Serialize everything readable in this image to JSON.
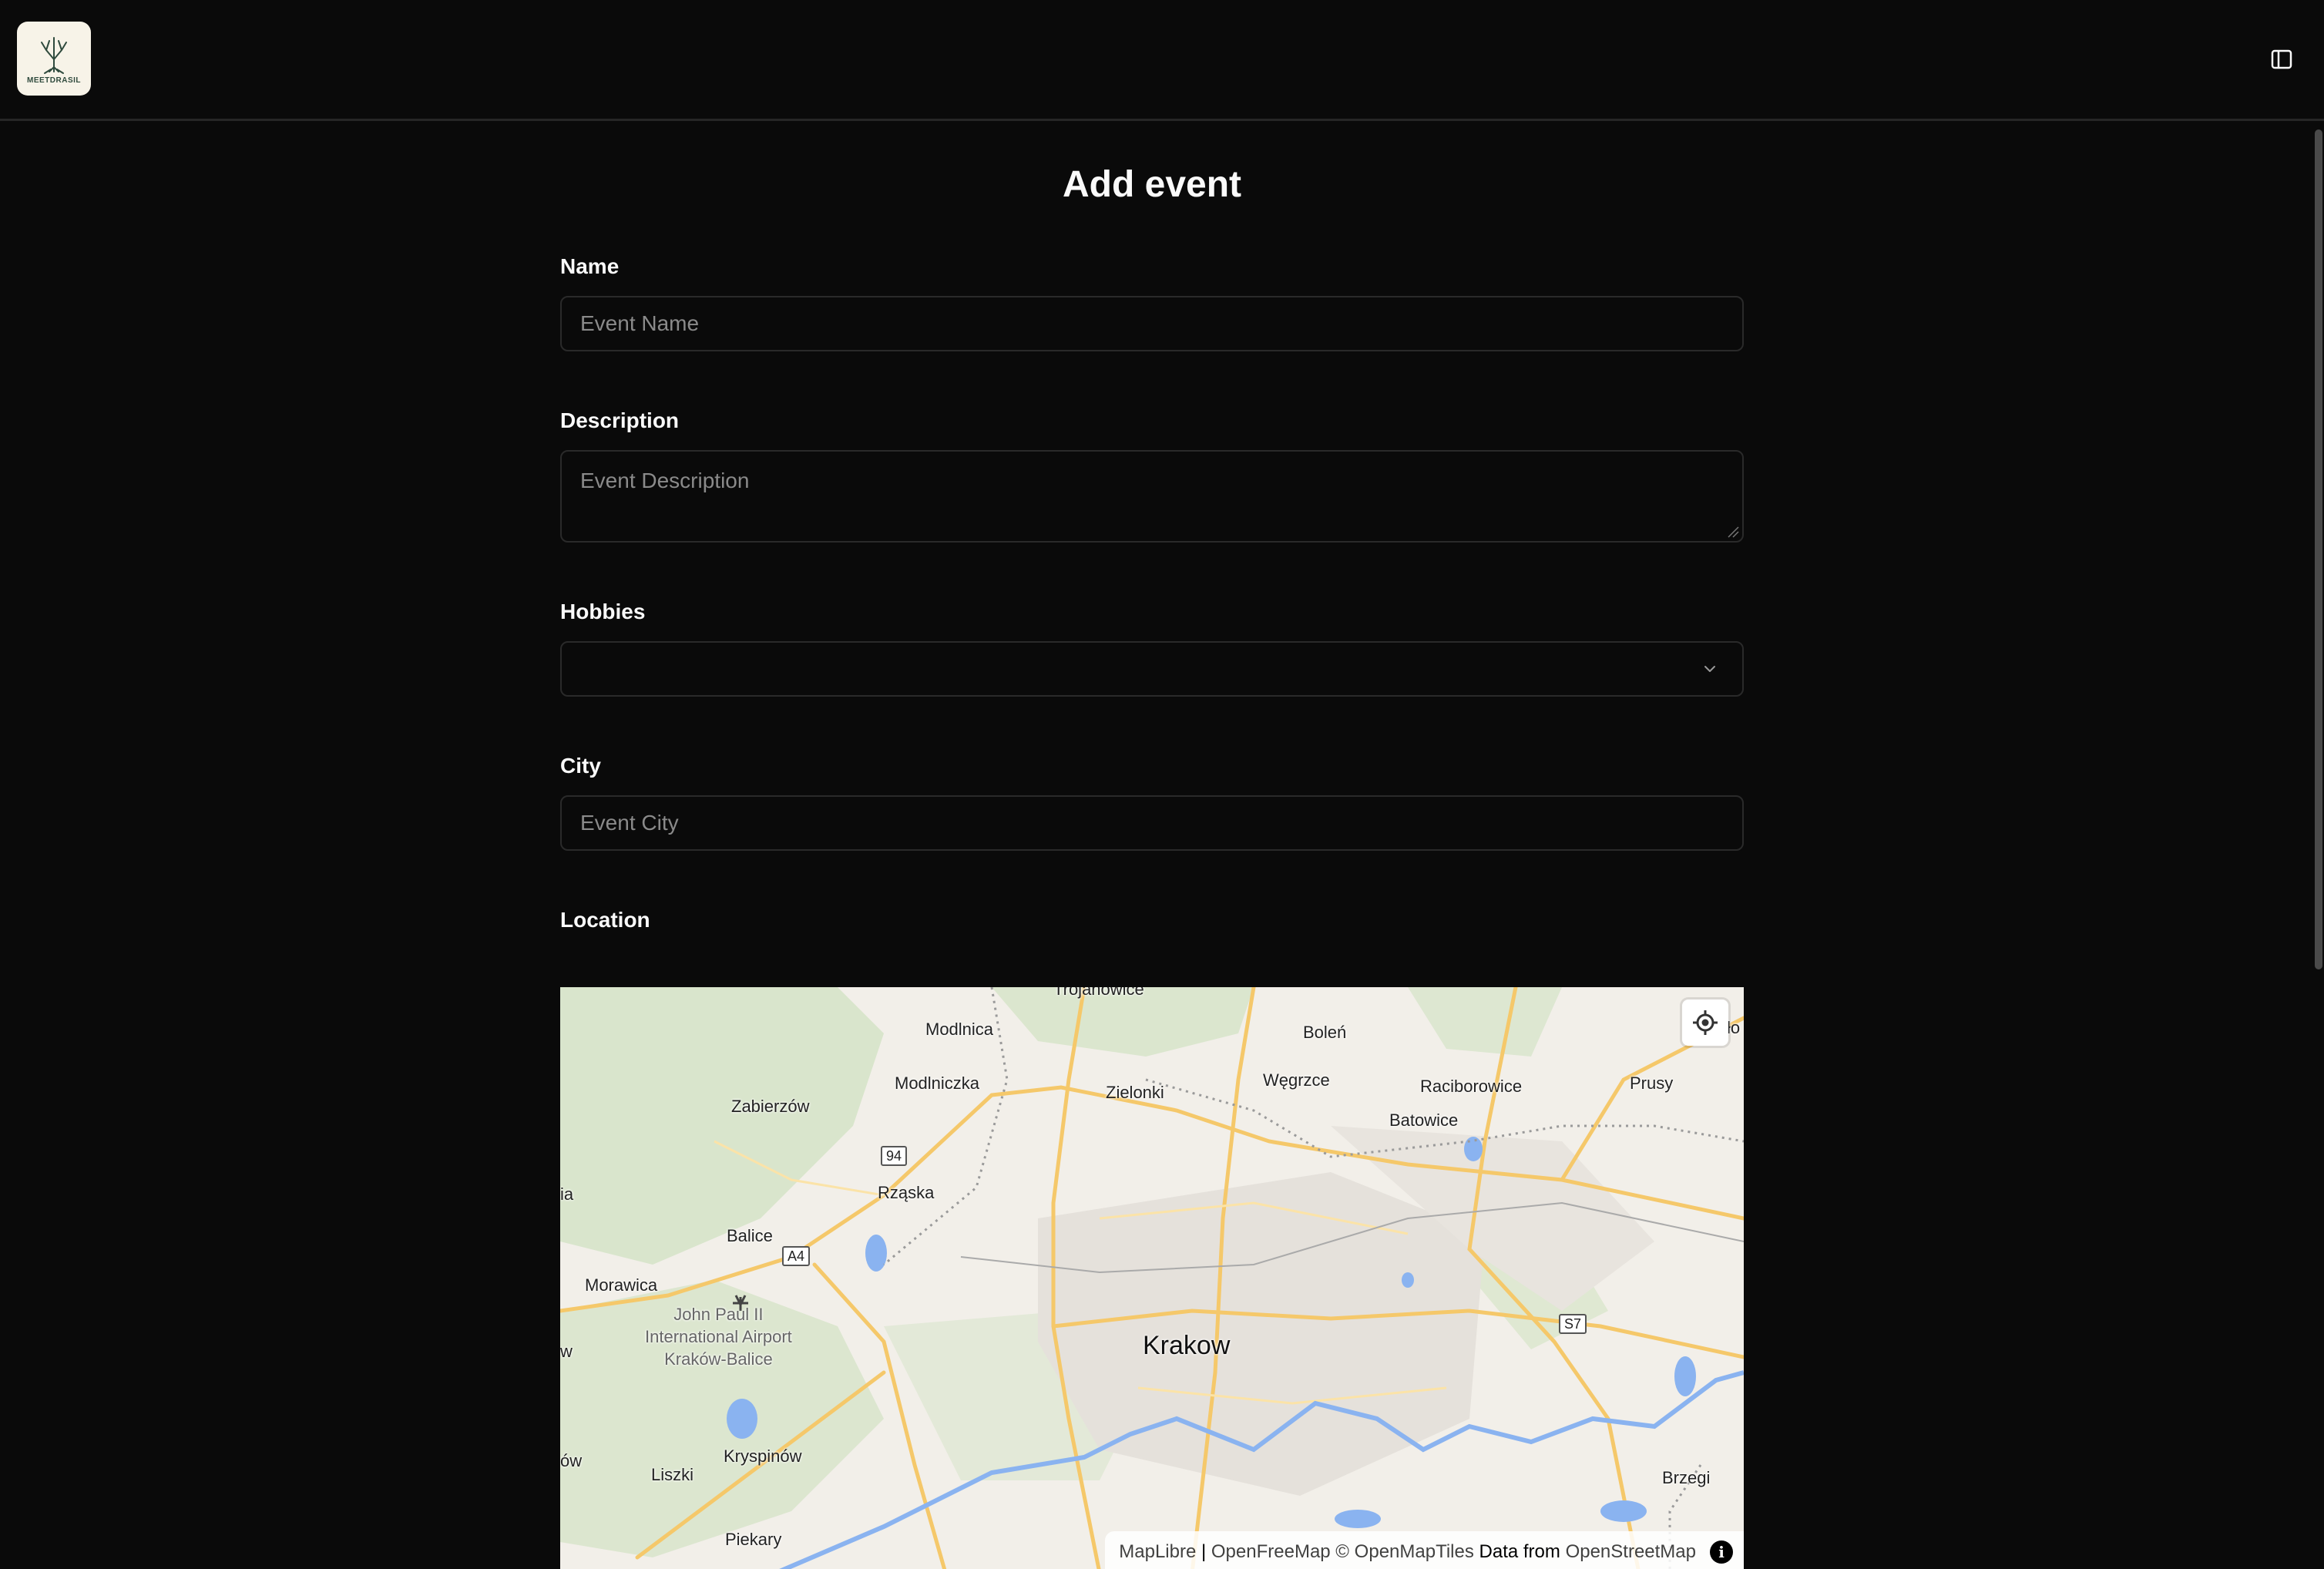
{
  "app": {
    "logo_text": "MEETDRASIL",
    "icons": {
      "logo": "tree-icon",
      "sidebar_toggle": "sidebar-toggle-icon"
    }
  },
  "form": {
    "title": "Add event",
    "name": {
      "label": "Name",
      "placeholder": "Event Name",
      "value": ""
    },
    "description": {
      "label": "Description",
      "placeholder": "Event Description",
      "value": ""
    },
    "hobbies": {
      "label": "Hobbies",
      "value": ""
    },
    "city": {
      "label": "City",
      "placeholder": "Event City",
      "value": ""
    },
    "location": {
      "label": "Location"
    }
  },
  "map": {
    "center_label": "Krakow",
    "places": [
      "Trojanowice",
      "Modlnica",
      "Boleń",
      "Modlniczka",
      "Zielonki",
      "Węgrzce",
      "Raciborowice",
      "Prusy",
      "Zabierzów",
      "Batowice",
      "Rząska",
      "Balice",
      "Morawica",
      "Kryspinów",
      "Liszki",
      "Piekary",
      "Brzegi"
    ],
    "airport": [
      "John Paul II",
      "International Airport",
      "Kraków-Balice"
    ],
    "road_shields": [
      "94",
      "A4",
      "S7"
    ],
    "edge_fragments": [
      "ia",
      "w",
      "ów",
      "ło"
    ],
    "attribution": {
      "maplibre": "MapLibre",
      "sep": " | ",
      "openfreemap": "OpenFreeMap",
      "copy": " © ",
      "openmaptiles": "OpenMapTiles",
      "data_from": " Data from ",
      "osm": "OpenStreetMap"
    },
    "colors": {
      "land": "#f2efe9",
      "forest": "#d6e3c8",
      "water": "#8ab3f0",
      "road": "#f5c86a",
      "urban": "#e4e0da"
    }
  }
}
